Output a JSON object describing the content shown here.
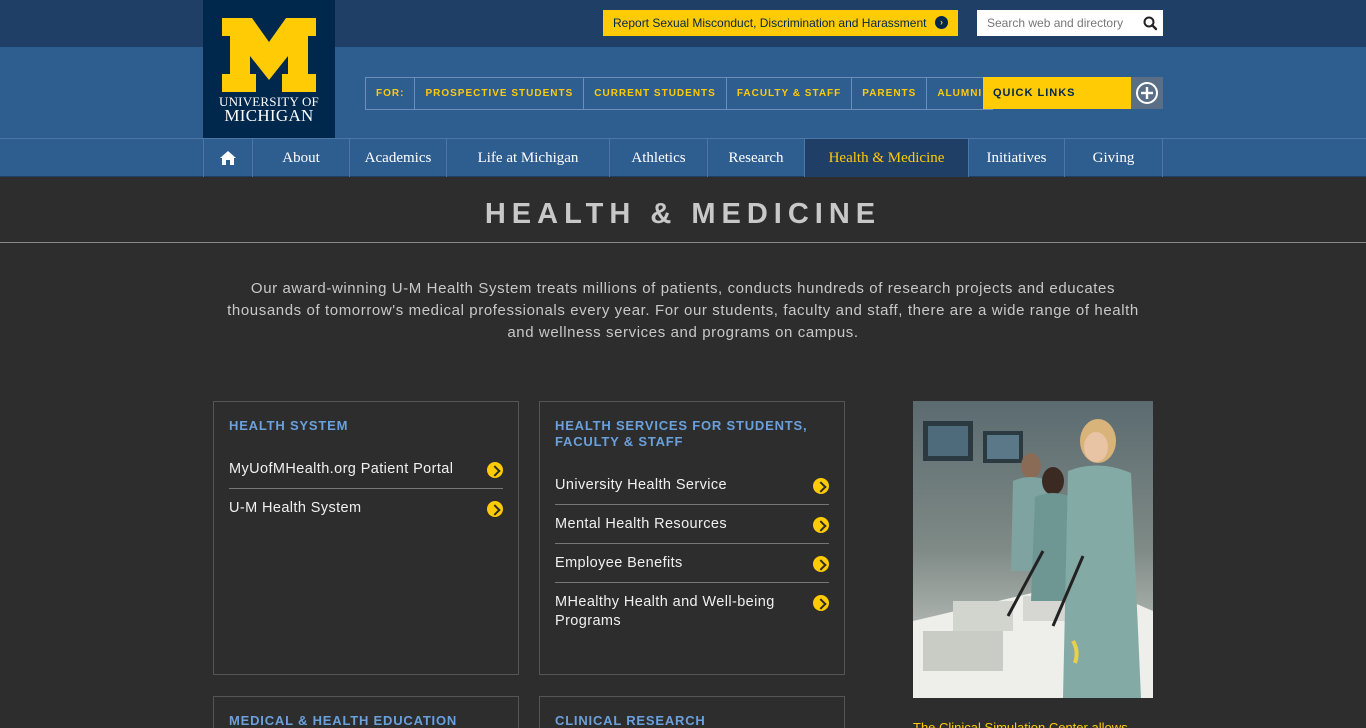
{
  "header": {
    "logo": {
      "letter": "M",
      "line1": "UNIVERSITY OF",
      "line2": "MICHIGAN"
    },
    "report_label": "Report Sexual Misconduct, Discrimination and Harassment",
    "search": {
      "placeholder": "Search web and directory",
      "value": ""
    },
    "audience": {
      "prefix": "FOR:",
      "items": [
        "PROSPECTIVE STUDENTS",
        "CURRENT STUDENTS",
        "FACULTY & STAFF",
        "PARENTS",
        "ALUMNI"
      ]
    },
    "quick_links_label": "QUICK LINKS"
  },
  "nav": {
    "home_icon": "home-icon",
    "items": [
      {
        "label": "About"
      },
      {
        "label": "Academics"
      },
      {
        "label": "Life at Michigan"
      },
      {
        "label": "Athletics"
      },
      {
        "label": "Research"
      },
      {
        "label": "Health & Medicine",
        "active": true
      },
      {
        "label": "Initiatives"
      },
      {
        "label": "Giving"
      }
    ]
  },
  "page": {
    "title": "HEALTH & MEDICINE",
    "intro": "Our award-winning U-M Health System treats millions of patients, conducts hundreds of research projects and educates thousands of tomorrow's medical professionals every year. For our students, faculty and staff, there are a wide range of health and wellness services and programs on campus."
  },
  "cards": {
    "health_system": {
      "title": "HEALTH SYSTEM",
      "links": [
        "MyUofMHealth.org Patient Portal",
        "U-M Health System"
      ]
    },
    "health_services": {
      "title": "HEALTH SERVICES FOR STUDENTS, FACULTY & STAFF",
      "links": [
        "University Health Service",
        "Mental Health Resources",
        "Employee Benefits",
        "MHealthy Health and Well-being Programs"
      ]
    },
    "medical_education": {
      "title": "MEDICAL & HEALTH EDUCATION"
    },
    "clinical_research": {
      "title": "CLINICAL RESEARCH"
    }
  },
  "feature": {
    "caption": "The Clinical Simulation Center allows"
  },
  "colors": {
    "maize": "#ffcb05",
    "blue_dark": "#00274c",
    "blue_mid": "#2e5d90",
    "blue_top": "#1f3f66",
    "heading_blue": "#6aa0dc",
    "background": "#2d2d2d"
  }
}
